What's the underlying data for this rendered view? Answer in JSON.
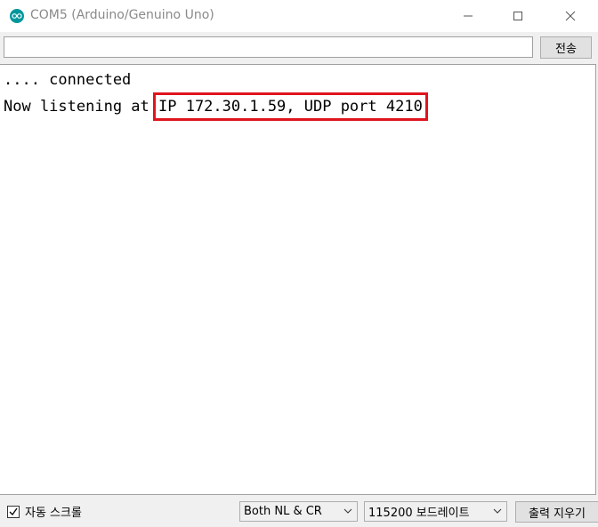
{
  "window": {
    "title": "COM5 (Arduino/Genuino Uno)",
    "accent_color": "#00979c",
    "icon": "arduino-icon"
  },
  "send": {
    "input_value": "",
    "button_label": "전송"
  },
  "output": {
    "lines": [
      ".... connected",
      "Now listening at "
    ],
    "highlighted_text": "IP 172.30.1.59, UDP port 4210",
    "highlight_color": "#e0141e"
  },
  "bottom": {
    "autoscroll_label": "자동 스크롤",
    "autoscroll_checked": true,
    "line_ending": "Both NL & CR",
    "baud_rate": "115200 보드레이트",
    "clear_label": "출력 지우기"
  }
}
